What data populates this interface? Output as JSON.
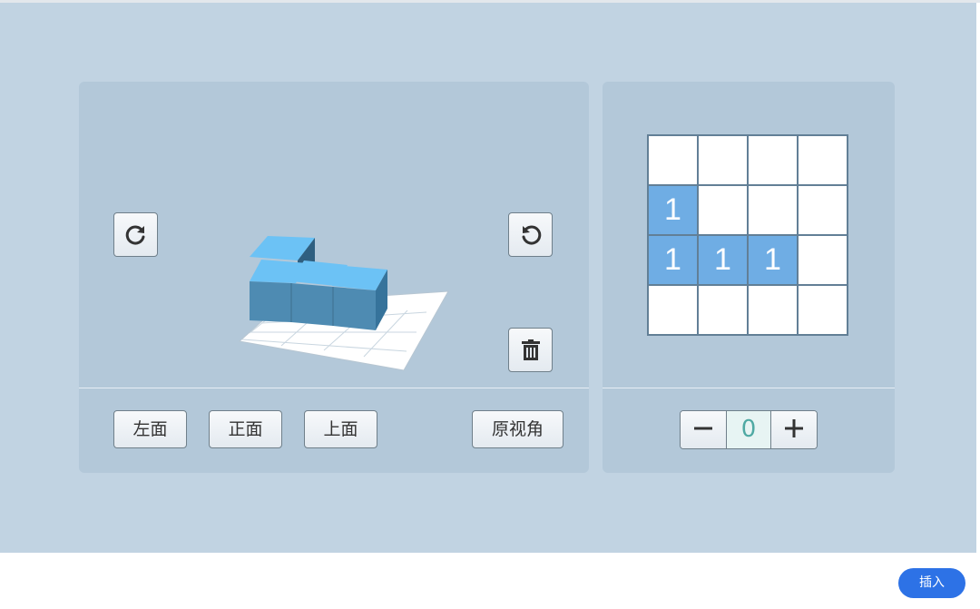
{
  "left_panel": {
    "view_buttons": [
      "左面",
      "正面",
      "上面"
    ],
    "reset_view_label": "原视角",
    "rotate_cw_icon": "rotate-clockwise-icon",
    "rotate_ccw_icon": "rotate-counterclockwise-icon",
    "delete_icon": "trash-icon"
  },
  "right_panel": {
    "grid": [
      [
        "",
        "",
        "",
        ""
      ],
      [
        "1",
        "",
        "",
        ""
      ],
      [
        "1",
        "1",
        "1",
        ""
      ],
      [
        "",
        "",
        "",
        ""
      ]
    ],
    "stepper": {
      "minus_icon": "minus-icon",
      "value": "0",
      "plus_icon": "plus-icon"
    }
  },
  "footer": {
    "insert_label": "插入"
  },
  "colors": {
    "stage": "#c1d3e2",
    "panel": "#b3c8d9",
    "filled_cell": "#6fade4",
    "cube_top": "#6cc2f5",
    "cube_front": "#4e8bb2",
    "insert_button": "#2d72e6"
  }
}
